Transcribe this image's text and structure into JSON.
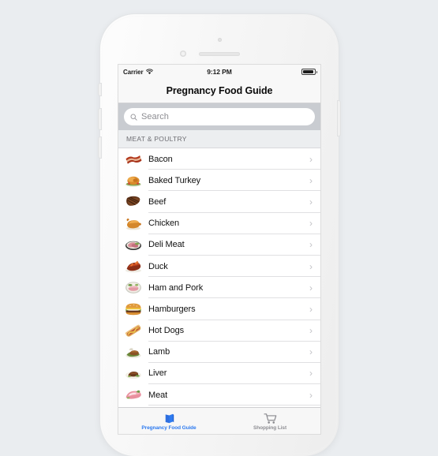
{
  "device": {
    "name": "iphone-white-frame",
    "hardware": {
      "front_camera": "camera-icon",
      "proximity_sensor": "proximity-sensor-icon",
      "earpiece_speaker": "speaker-grille",
      "mute_switch": "mute-switch",
      "volume_up": "volume-up-button",
      "volume_down": "volume-down-button",
      "power": "power-button"
    },
    "background_color": "#eaedf0",
    "body_color": "#f7f7f7"
  },
  "status_bar": {
    "carrier": "Carrier",
    "wifi_icon": "wifi-icon",
    "time": "9:12 PM",
    "battery_icon": "battery-icon",
    "battery_level_percent": 92
  },
  "nav_bar": {
    "title": "Pregnancy Food Guide"
  },
  "search": {
    "icon": "search-icon",
    "placeholder": "Search",
    "value": ""
  },
  "section": {
    "header": "MEAT & POULTRY"
  },
  "list": {
    "chevron_icon": "chevron-right-icon",
    "items": [
      {
        "label": "Bacon",
        "thumb": "bacon-thumbnail"
      },
      {
        "label": "Baked Turkey",
        "thumb": "baked-turkey-thumbnail"
      },
      {
        "label": "Beef",
        "thumb": "beef-steak-thumbnail"
      },
      {
        "label": "Chicken",
        "thumb": "roast-chicken-thumbnail"
      },
      {
        "label": "Deli Meat",
        "thumb": "deli-meat-thumbnail"
      },
      {
        "label": "Duck",
        "thumb": "duck-thumbnail"
      },
      {
        "label": "Ham and Pork",
        "thumb": "ham-and-pork-thumbnail"
      },
      {
        "label": "Hamburgers",
        "thumb": "hamburger-thumbnail"
      },
      {
        "label": "Hot Dogs",
        "thumb": "hot-dog-thumbnail"
      },
      {
        "label": "Lamb",
        "thumb": "lamb-thumbnail"
      },
      {
        "label": "Liver",
        "thumb": "liver-thumbnail"
      },
      {
        "label": "Meat",
        "thumb": "raw-meat-thumbnail"
      }
    ]
  },
  "tab_bar": {
    "active_color": "#2e7bf0",
    "inactive_color": "#8e8e93",
    "tabs": [
      {
        "label": "Pregnancy Food Guide",
        "icon": "book-icon",
        "active": true
      },
      {
        "label": "Shopping List",
        "icon": "shopping-cart-icon",
        "active": false
      }
    ]
  }
}
